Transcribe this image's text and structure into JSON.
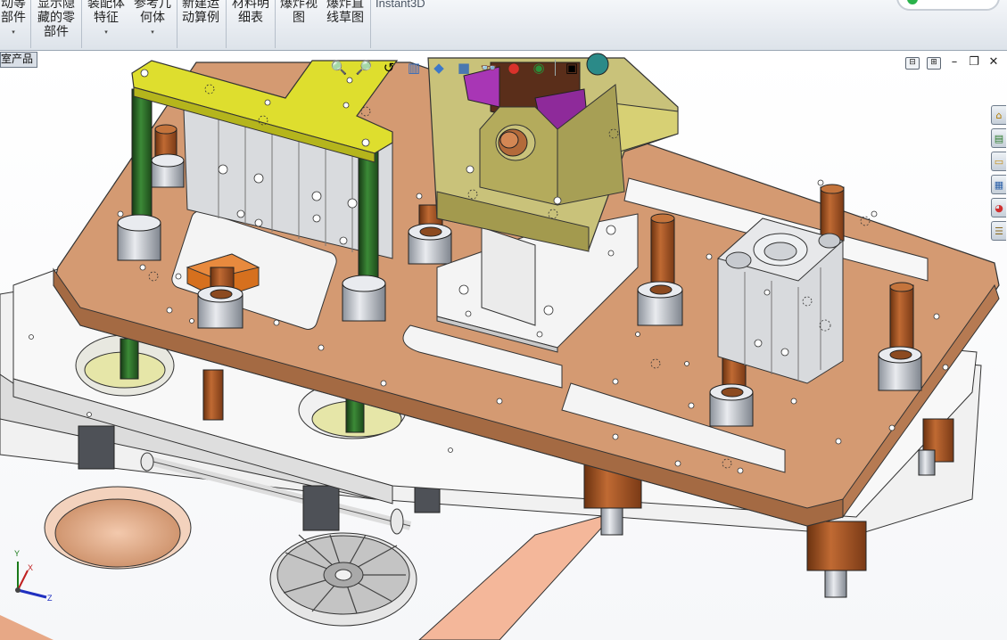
{
  "ribbon": {
    "buttons": [
      {
        "id": "mate-parts",
        "lines": [
          "动等",
          "部件"
        ],
        "caret": true
      },
      {
        "id": "show-hidden",
        "lines": [
          "显示隐",
          "藏的零",
          "部件"
        ],
        "caret": true
      },
      {
        "id": "assembly-feature",
        "lines": [
          "装配体",
          "特征"
        ],
        "caret": true
      },
      {
        "id": "reference-geometry",
        "lines": [
          "参考几",
          "何体"
        ],
        "caret": true
      },
      {
        "id": "new-motion-study",
        "lines": [
          "新建运",
          "动算例"
        ],
        "caret": false
      },
      {
        "id": "bill-of-materials",
        "lines": [
          "材料明",
          "细表"
        ],
        "caret": false
      },
      {
        "id": "exploded-view",
        "lines": [
          "爆炸视",
          "图"
        ],
        "caret": false
      },
      {
        "id": "explode-line-sketch",
        "lines": [
          "爆炸直",
          "线草图"
        ],
        "caret": false
      }
    ],
    "instant3d": "Instant3D"
  },
  "tree_tag": "室产品",
  "hud": {
    "icons": [
      "zoom-to-fit-icon",
      "zoom-area-icon",
      "previous-view-icon",
      "section-view-icon",
      "view-orientation-icon",
      "display-style-icon",
      "hide-show-icon",
      "edit-appearance-icon",
      "apply-scene-icon",
      "view-settings-icon"
    ]
  },
  "window_controls": [
    "tile-icon",
    "tile-icon-2",
    "minimize-icon",
    "restore-icon",
    "close-icon"
  ],
  "task_pane": [
    "home-icon",
    "design-library-icon",
    "file-explorer-icon",
    "view-palette-icon",
    "appearances-icon",
    "custom-properties-icon"
  ],
  "triad": {
    "x": "X",
    "y": "Y",
    "z": "Z"
  },
  "colors": {
    "top_plate": "#d49a72",
    "bracket_yellow": "#dede2e",
    "cylinder_gray": "#d6d8dc",
    "rod_green": "#2f6b2c",
    "rod_copper": "#a85a28",
    "olive_block": "#c9c27a",
    "purple_part": "#9a2fa6",
    "lower_plate": "#f2f2f2"
  }
}
